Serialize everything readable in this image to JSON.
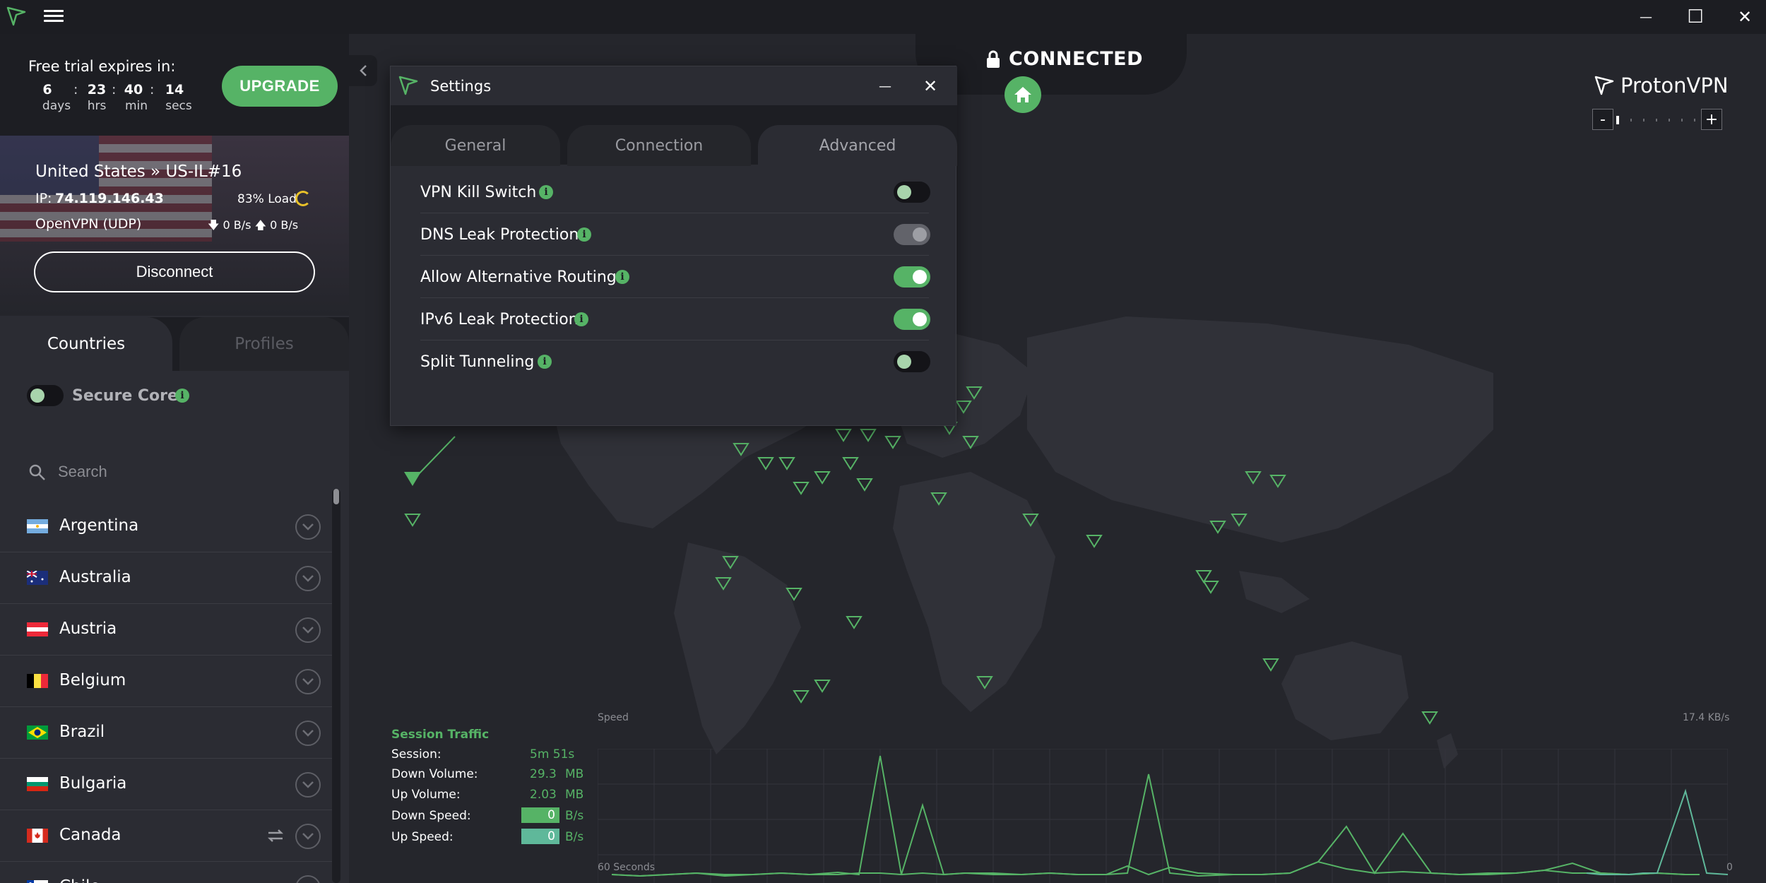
{
  "window": {
    "minimize_glyph": "—",
    "maximize_glyph": "☐",
    "close_glyph": "✕"
  },
  "trial": {
    "title": "Free trial expires in:",
    "days": "6",
    "days_label": "days",
    "hrs": "23",
    "hrs_label": "hrs",
    "min": "40",
    "min_label": "min",
    "secs": "14",
    "secs_label": "secs",
    "separator": ":",
    "upgrade_label": "UPGRADE"
  },
  "connection": {
    "server": "United States » US-IL#16",
    "ip_label": "IP:",
    "ip": "74.119.146.43",
    "load": "83% Load",
    "protocol": "OpenVPN (UDP)",
    "speed": "🡇 0 B/s 🡅 0 B/s",
    "disconnect_label": "Disconnect"
  },
  "sidebar": {
    "tab_countries": "Countries",
    "tab_profiles": "Profiles",
    "secure_core_label": "Secure Core",
    "search_placeholder": "Search",
    "info_glyph": "i",
    "countries": [
      {
        "name": "Argentina"
      },
      {
        "name": "Australia"
      },
      {
        "name": "Austria"
      },
      {
        "name": "Belgium"
      },
      {
        "name": "Brazil"
      },
      {
        "name": "Bulgaria"
      },
      {
        "name": "Canada"
      },
      {
        "name": "Chile"
      }
    ]
  },
  "map": {
    "status": "CONNECTED",
    "brand": "ProtonVPN",
    "zoom_out": "-",
    "zoom_in": "+"
  },
  "settings": {
    "title": "Settings",
    "minimize_glyph": "—",
    "close_glyph": "✕",
    "tabs": {
      "general": "General",
      "connection": "Connection",
      "advanced": "Advanced"
    },
    "items": [
      {
        "label": "VPN Kill Switch",
        "state": "off"
      },
      {
        "label": "DNS Leak Protection",
        "state": "disabled-on"
      },
      {
        "label": "Allow Alternative Routing",
        "state": "on"
      },
      {
        "label": "IPv6 Leak Protection",
        "state": "on"
      },
      {
        "label": "Split Tunneling",
        "state": "off"
      }
    ]
  },
  "traffic": {
    "title": "Session Traffic",
    "session_label": "Session:",
    "session_value": "5m 51s",
    "down_volume_label": "Down Volume:",
    "down_volume_value": "29.3",
    "down_volume_unit": "MB",
    "up_volume_label": "Up Volume:",
    "up_volume_value": "2.03",
    "up_volume_unit": "MB",
    "down_speed_label": "Down Speed:",
    "down_speed_value": "0",
    "down_speed_unit": "B/s",
    "up_speed_label": "Up Speed:",
    "up_speed_value": "0",
    "up_speed_unit": "B/s",
    "chart_speed_label": "Speed",
    "chart_max_label": "17.4 KB/s",
    "chart_time_label": "60 Seconds",
    "chart_zero_label": "0"
  },
  "colors": {
    "accent": "#56b366",
    "background": "#25262c",
    "panel": "#2b2c33",
    "dark": "#1d1e23"
  }
}
